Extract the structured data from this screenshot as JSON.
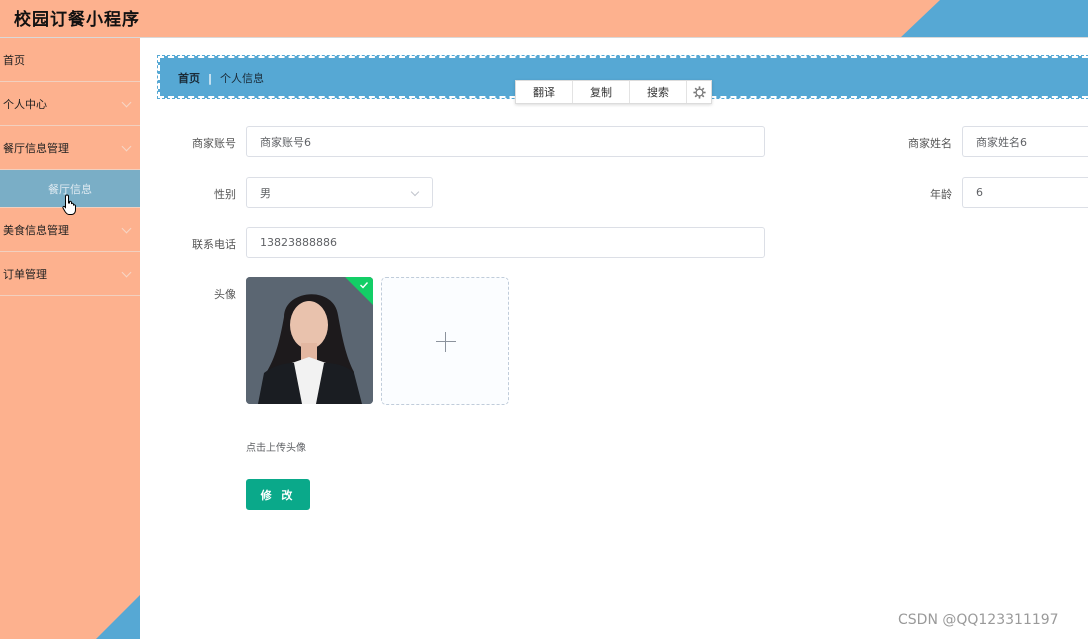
{
  "app": {
    "title": "校园订餐小程序"
  },
  "sidebar": {
    "items": [
      {
        "label": "首页"
      },
      {
        "label": "个人中心"
      },
      {
        "label": "餐厅信息管理"
      },
      {
        "label": "餐厅信息"
      },
      {
        "label": "美食信息管理"
      },
      {
        "label": "订单管理"
      }
    ]
  },
  "breadcrumb": {
    "home": "首页",
    "separator": "|",
    "current": "个人信息"
  },
  "floating_toolbar": {
    "translate": "翻译",
    "copy": "复制",
    "search": "搜索",
    "settings_icon": "gear-icon"
  },
  "form": {
    "account": {
      "label": "商家账号",
      "value": "商家账号6"
    },
    "name": {
      "label": "商家姓名",
      "value": "商家姓名6"
    },
    "gender": {
      "label": "性别",
      "value": "男"
    },
    "age": {
      "label": "年龄",
      "value": "6"
    },
    "phone": {
      "label": "联系电话",
      "value": "13823888886"
    },
    "avatar": {
      "label": "头像",
      "hint": "点击上传头像"
    },
    "submit": "修 改"
  },
  "watermark": "CSDN @QQ123311197",
  "colors": {
    "sidebar_bg": "#fdb18e",
    "accent_blue": "#56a8d4",
    "submenu_active": "#7aaec6",
    "submit_green": "#0aa98a",
    "success_badge": "#13ce66"
  }
}
